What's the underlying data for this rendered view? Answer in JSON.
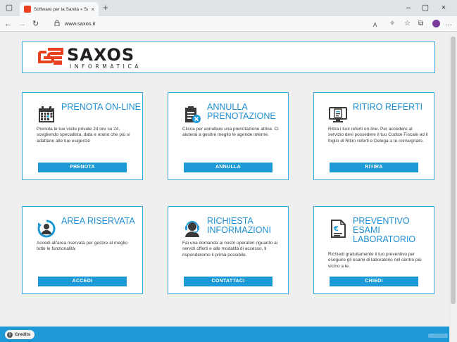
{
  "browser": {
    "tab_title": "Software per la Sanità » Saxos In",
    "tab_close": "×",
    "new_tab": "+",
    "url": "www.saxos.it",
    "window_controls": {
      "minimize": "–",
      "maximize": "▢",
      "close": "×"
    }
  },
  "header": {
    "brand": "SAXOS",
    "brand_sub": "INFORMATICA"
  },
  "cards": [
    {
      "title": "PRENOTA ON-LINE",
      "icon": "calendar-icon",
      "description": "Prenota le tue visite private 24 ore su 24, scegliendo specialista, data e orario che più si adattano alle tue esigenze",
      "button": "PRENOTA"
    },
    {
      "title": "ANNULLA PRENOTAZIONE",
      "icon": "cancel-booking-icon",
      "description": "Clicca per annullare una prenotazione attiva. Ci aiuterai a gestire meglio le agende interne.",
      "button": "ANNULLA"
    },
    {
      "title": "RITIRO REFERTI",
      "icon": "report-screen-icon",
      "description": "Ritira i tuoi referti on-line. Per accedere al servizio devi possedere il tuo Codice Fiscale ed il foglio di Ritiro referti e Delega a te consegnato.",
      "button": "RITIRA"
    },
    {
      "title": "AREA RISERVATA",
      "icon": "user-refresh-icon",
      "description": "Accedi all'area riservata per gestire al meglio tutte le funzionalità.",
      "button": "ACCEDI"
    },
    {
      "title": "RICHIESTA INFORMAZIONI",
      "icon": "operator-headset-icon",
      "description": "Fai una domanda ai nostri operatori riguardo ai servizi offerti e alle modalità di accesso, ti risponderemo il prima possibile.",
      "button": "CONTATTACI"
    },
    {
      "title": "PREVENTIVO ESAMI LABORATORIO",
      "icon": "euro-document-icon",
      "description": "Richiedi gratuitamente il tuo preventivo per eseguire gli esami di laboratorio nel centro più vicino a te.",
      "button": "CHIEDI"
    }
  ],
  "footer": {
    "credits": "Credits"
  },
  "colors": {
    "accent": "#1d9ad6",
    "title_blue": "#1f8fd3",
    "brand_red": "#e8411f"
  }
}
